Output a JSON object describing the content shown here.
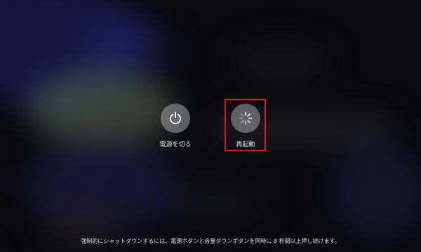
{
  "options": {
    "power_off": {
      "label": "電源を切る",
      "icon": "power-icon"
    },
    "restart": {
      "label": "再起動",
      "icon": "spinner-icon",
      "highlighted": true
    }
  },
  "footer": {
    "hint": "強制的にシャットダウンするには、電源ボタンと音量ダウンボタンを同時に 8 秒間以上押し続けます。"
  },
  "colors": {
    "highlight_border": "#e11a1a",
    "button_fill": "#cdcdd2",
    "text": "#e6e6e6"
  }
}
